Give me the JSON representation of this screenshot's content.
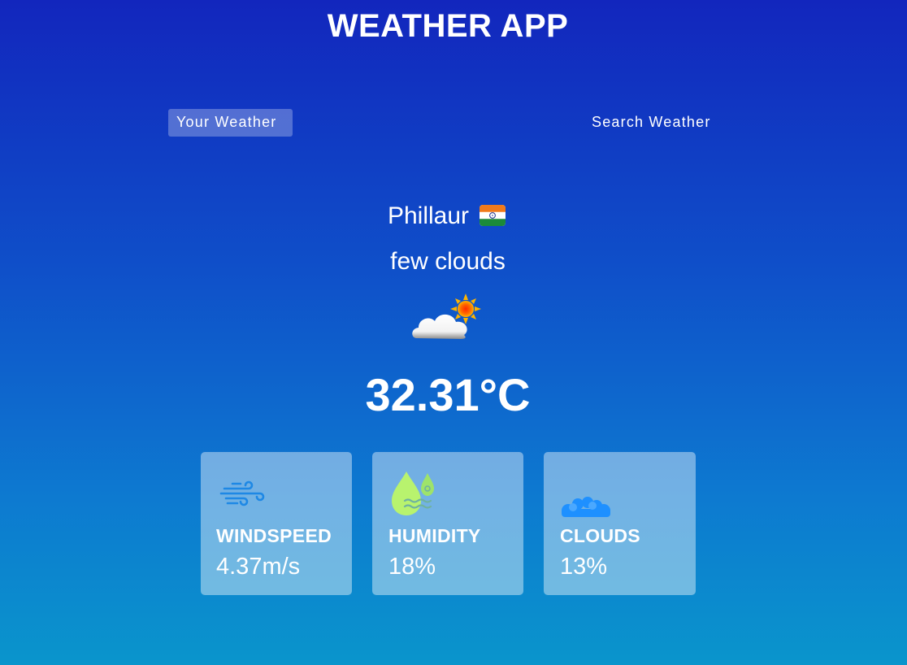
{
  "app": {
    "title": "WEATHER APP"
  },
  "tabs": [
    {
      "label": "Your Weather",
      "active": true
    },
    {
      "label": "Search Weather",
      "active": false
    }
  ],
  "weather": {
    "city": "Phillaur",
    "country_flag_icon": "india-flag-icon",
    "description": "few clouds",
    "condition_icon": "sun-behind-cloud-icon",
    "temperature": "32.31°C"
  },
  "stats": [
    {
      "icon": "wind-icon",
      "label": "WINDSPEED",
      "value": "4.37m/s"
    },
    {
      "icon": "humidity-drops-icon",
      "label": "HUMIDITY",
      "value": "18%"
    },
    {
      "icon": "clouds-icon",
      "label": "CLOUDS",
      "value": "13%"
    }
  ],
  "colors": {
    "background_top": "#1226bd",
    "background_bottom": "#0a95cc",
    "wind_icon": "#1e88e5",
    "humidity_icon": "#b8f36e",
    "clouds_icon": "#1e90ff"
  }
}
